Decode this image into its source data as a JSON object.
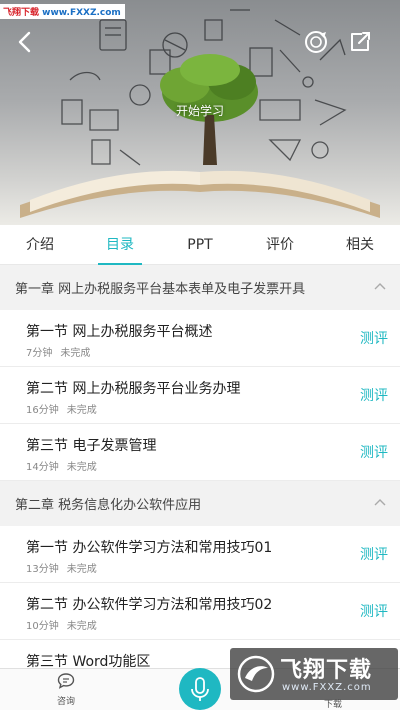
{
  "watermark_top": {
    "brand": "飞翔下载",
    "url": "www.FXXZ.com"
  },
  "hero": {
    "start_label": "开始学习"
  },
  "tabs": [
    {
      "label": "介绍",
      "active": false
    },
    {
      "label": "目录",
      "active": true
    },
    {
      "label": "PPT",
      "active": false
    },
    {
      "label": "评价",
      "active": false
    },
    {
      "label": "相关",
      "active": false
    }
  ],
  "chapters": [
    {
      "title": "第一章 网上办税服务平台基本表单及电子发票开具",
      "sections": [
        {
          "title": "第一节 网上办税服务平台概述",
          "duration": "7分钟",
          "status": "未完成",
          "action": "测评"
        },
        {
          "title": "第二节 网上办税服务平台业务办理",
          "duration": "16分钟",
          "status": "未完成",
          "action": "测评"
        },
        {
          "title": "第三节 电子发票管理",
          "duration": "14分钟",
          "status": "未完成",
          "action": "测评"
        }
      ]
    },
    {
      "title": "第二章 税务信息化办公软件应用",
      "sections": [
        {
          "title": "第一节 办公软件学习方法和常用技巧01",
          "duration": "13分钟",
          "status": "未完成",
          "action": "测评"
        },
        {
          "title": "第二节 办公软件学习方法和常用技巧02",
          "duration": "10分钟",
          "status": "未完成",
          "action": "测评"
        },
        {
          "title": "第三节 Word功能区"
        }
      ]
    }
  ],
  "bottom_bar": {
    "consult_label": "咨询",
    "download_label": "下载"
  },
  "watermark_bottom": {
    "name": "飞翔下载",
    "url": "www.FXXZ.com"
  },
  "colors": {
    "accent": "#1fb8c2"
  }
}
